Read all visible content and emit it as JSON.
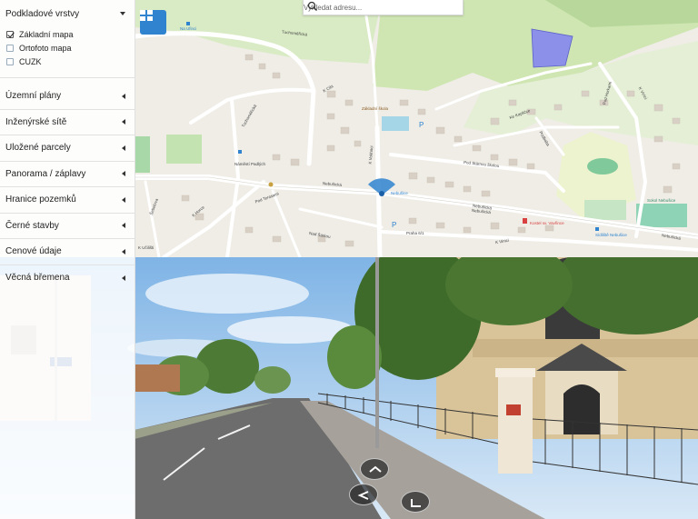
{
  "search": {
    "placeholder": "Vyhledat adresu..."
  },
  "sidebar": {
    "base_layers": {
      "title": "Podkladové vrstvy",
      "items": [
        {
          "label": "Základní mapa",
          "checked": true
        },
        {
          "label": "Ortofoto mapa",
          "checked": false
        },
        {
          "label": "CUZK",
          "checked": false
        }
      ]
    },
    "sections": [
      {
        "label": "Územní plány"
      },
      {
        "label": "Inženýrské sítě"
      },
      {
        "label": "Uložené parcely"
      },
      {
        "label": "Panorama / záplavy"
      },
      {
        "label": "Hranice pozemků"
      },
      {
        "label": "Černé stavby"
      },
      {
        "label": "Cenové údaje"
      },
      {
        "label": "Věcná břemena"
      }
    ]
  },
  "map": {
    "labels": {
      "station": "Na Ufinci",
      "street1": "Tuchoměřická",
      "street2": "Tuchoměřická",
      "street3": "K Cibi",
      "street4": "Nebušická",
      "street5": "Nebušická",
      "street6": "Nebušická",
      "street7": "Pod Stárnou školou",
      "street8": "K Vokhnci",
      "school": "Základní škola",
      "post": "Praha 6/1",
      "street9": "Pod Terasami",
      "street10": "K Horce",
      "street11": "Nad Šárkou",
      "street12": "K Učilišti",
      "street13": "Nebušická",
      "street14": "K Vinici",
      "square": "Náměstí Padlých",
      "stop": "Nebušice",
      "church": "Kostel sv. Vavřince",
      "stop2": "Sídliště Nebušice",
      "field": "Sokol Nebušice",
      "street15": "Ke Kapličce",
      "street16": "Pod Horkami",
      "street17": "K Vinici",
      "street18": "Podbaba",
      "street19": "Šebelova"
    }
  },
  "colors": {
    "accent": "#2f83cf",
    "parcel": "#8c90e8"
  }
}
